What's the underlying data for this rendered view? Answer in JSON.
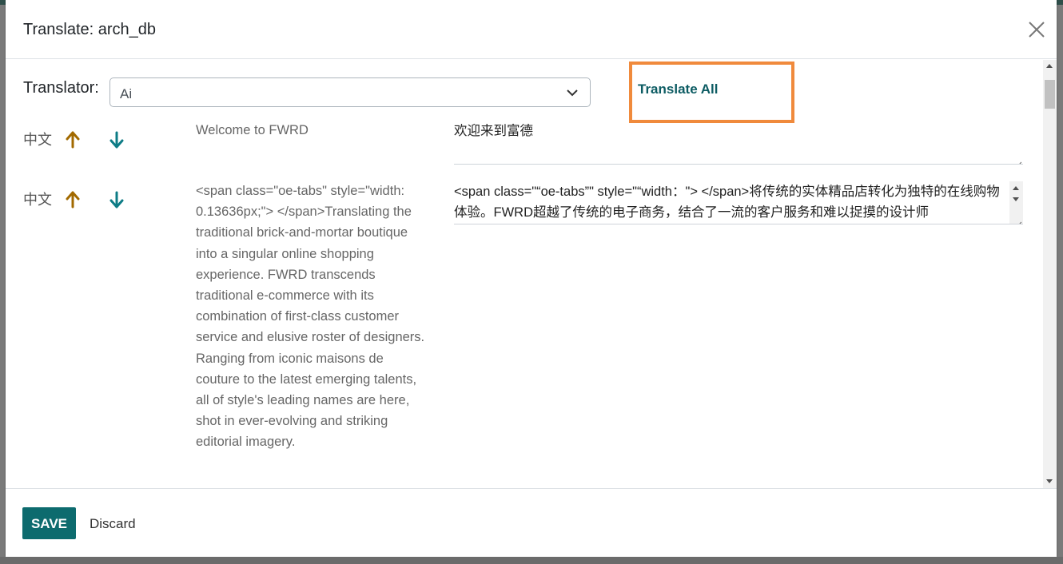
{
  "modal": {
    "title": "Translate: arch_db"
  },
  "translator": {
    "label": "Translator:",
    "selected": "Ai",
    "translate_all": "Translate All"
  },
  "rows": [
    {
      "lang": "中文",
      "source": "Welcome to FWRD",
      "target": "欢迎来到富德"
    },
    {
      "lang": "中文",
      "source": "<span class=\"oe-tabs\" style=\"width: 0.13636px;\"> </span>Translating the traditional brick-and-mortar boutique into a singular online shopping experience. FWRD transcends traditional e-commerce with its combination of first-class customer service and elusive roster of designers. Ranging from iconic maisons de couture to the latest emerging talents, all of style's leading names are here, shot in ever-evolving and striking editorial imagery.",
      "target": "<span class=\"“oe-tabs”\" style=\"“width：\"> </span>将传统的实体精品店转化为独特的在线购物体验。FWRD超越了传统的电子商务，结合了一流的客户服务和难以捉摸的设计师"
    }
  ],
  "footer": {
    "save_label": "SAVE",
    "discard_label": "Discard"
  },
  "colors": {
    "up_arrow": "#a26a00",
    "down_arrow": "#0e7c86",
    "highlight_box": "#f08a3c",
    "primary_button": "#0d6b6e"
  }
}
